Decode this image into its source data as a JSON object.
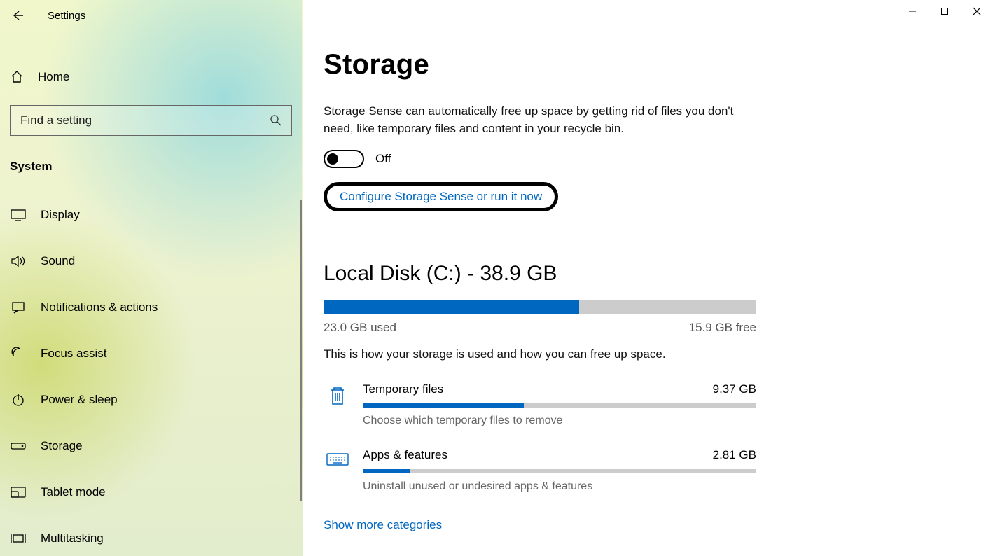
{
  "app": {
    "title": "Settings"
  },
  "sidebar": {
    "home_label": "Home",
    "search_placeholder": "Find a setting",
    "section_title": "System",
    "items": [
      {
        "label": "Display"
      },
      {
        "label": "Sound"
      },
      {
        "label": "Notifications & actions"
      },
      {
        "label": "Focus assist"
      },
      {
        "label": "Power & sleep"
      },
      {
        "label": "Storage"
      },
      {
        "label": "Tablet mode"
      },
      {
        "label": "Multitasking"
      }
    ]
  },
  "main": {
    "page_title": "Storage",
    "storage_sense_desc": "Storage Sense can automatically free up space by getting rid of files you don't need, like temporary files and content in your recycle bin.",
    "toggle_label": "Off",
    "configure_link": "Configure Storage Sense or run it now",
    "disk_title": "Local Disk (C:) - 38.9 GB",
    "used_label": "23.0 GB used",
    "free_label": "15.9 GB free",
    "used_fraction_pct": 59,
    "usage_desc": "This is how your storage is used and how you can free up space.",
    "categories": [
      {
        "name": "Temporary files",
        "size": "9.37 GB",
        "fill_pct": 41,
        "sub": "Choose which temporary files to remove",
        "icon": "trash"
      },
      {
        "name": "Apps & features",
        "size": "2.81 GB",
        "fill_pct": 12,
        "sub": "Uninstall unused or undesired apps & features",
        "icon": "keyboard"
      }
    ],
    "more_link": "Show more categories"
  }
}
